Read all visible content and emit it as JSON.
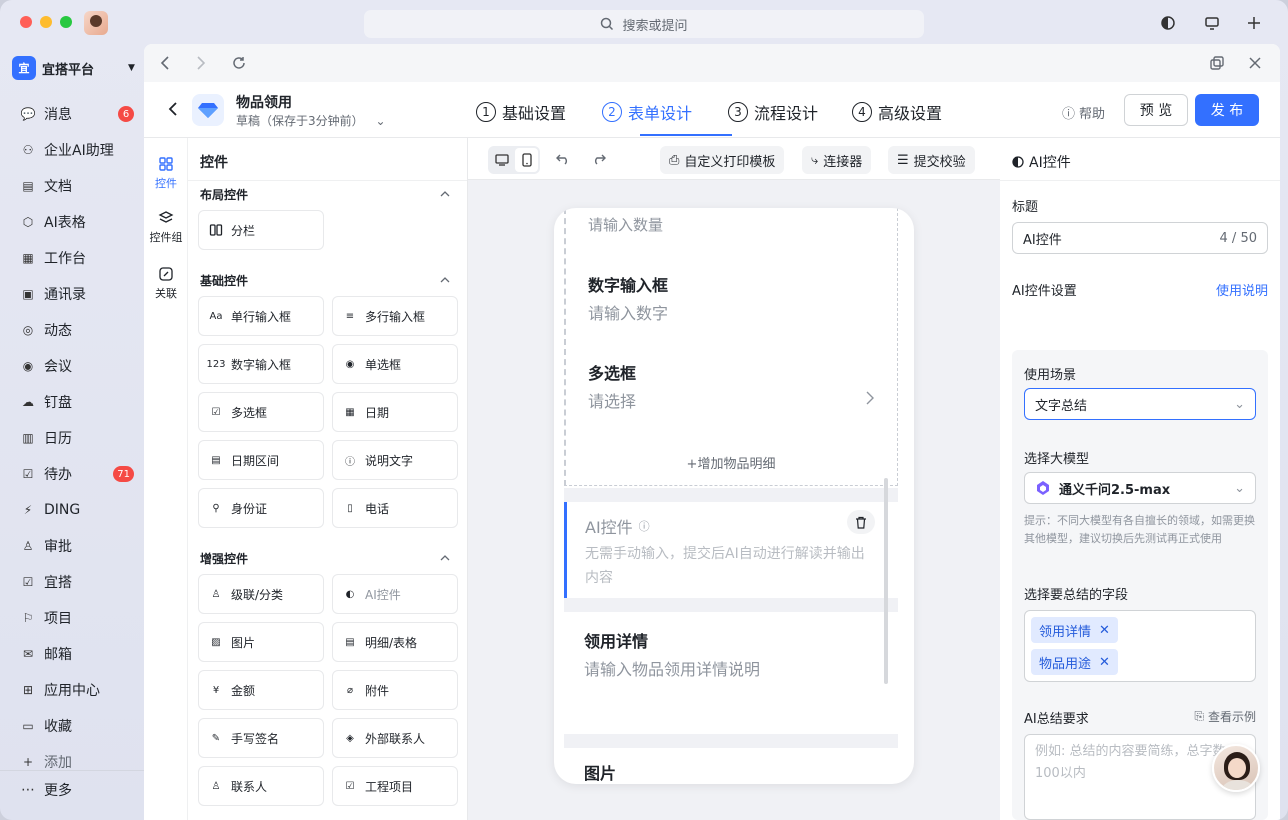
{
  "topbar": {
    "search_placeholder": "搜索或提问"
  },
  "org": {
    "logo_text": "宜",
    "name": "宜搭平台"
  },
  "nav": [
    {
      "label": "消息",
      "badge": "6",
      "icon": "chat-bubble-icon"
    },
    {
      "label": "企业AI助理",
      "icon": "ai-assistant-icon"
    },
    {
      "label": "文档",
      "icon": "document-icon"
    },
    {
      "label": "AI表格",
      "icon": "ai-table-icon"
    },
    {
      "label": "工作台",
      "icon": "grid-icon"
    },
    {
      "label": "通讯录",
      "icon": "contacts-icon"
    },
    {
      "label": "动态",
      "icon": "feed-icon"
    },
    {
      "label": "会议",
      "icon": "meeting-icon"
    },
    {
      "label": "钉盘",
      "icon": "cloud-drive-icon"
    },
    {
      "label": "日历",
      "icon": "calendar-icon"
    },
    {
      "label": "待办",
      "badge": "71",
      "icon": "todo-icon"
    },
    {
      "label": "DING",
      "icon": "ding-icon"
    },
    {
      "label": "审批",
      "icon": "approval-icon"
    },
    {
      "label": "宜搭",
      "icon": "yida-icon"
    },
    {
      "label": "项目",
      "icon": "project-icon"
    },
    {
      "label": "邮箱",
      "icon": "mail-icon"
    },
    {
      "label": "应用中心",
      "icon": "app-center-icon"
    },
    {
      "label": "收藏",
      "icon": "favorite-icon"
    },
    {
      "label": "添加",
      "icon": "add-icon"
    }
  ],
  "nav_more": "更多",
  "app": {
    "title": "物品领用",
    "subtitle": "草稿（保存于3分钟前）"
  },
  "steps": [
    {
      "num": "1",
      "label": "基础设置"
    },
    {
      "num": "2",
      "label": "表单设计"
    },
    {
      "num": "3",
      "label": "流程设计"
    },
    {
      "num": "4",
      "label": "高级设置"
    }
  ],
  "header_actions": {
    "help": "帮助",
    "preview": "预 览",
    "publish": "发 布"
  },
  "rail": [
    {
      "label": "控件"
    },
    {
      "label": "控件组"
    },
    {
      "label": "关联"
    }
  ],
  "widgets": {
    "title": "控件",
    "layout_title": "布局控件",
    "layout": [
      {
        "label": "分栏"
      }
    ],
    "basic_title": "基础控件",
    "basic": [
      {
        "label": "单行输入框",
        "glyph": "Aa"
      },
      {
        "label": "多行输入框",
        "glyph": "≡"
      },
      {
        "label": "数字输入框",
        "glyph": "123"
      },
      {
        "label": "单选框",
        "glyph": "◉"
      },
      {
        "label": "多选框",
        "glyph": "☑"
      },
      {
        "label": "日期",
        "glyph": "▦"
      },
      {
        "label": "日期区间",
        "glyph": "▤"
      },
      {
        "label": "说明文字",
        "glyph": "ⓘ"
      },
      {
        "label": "身份证",
        "glyph": "⚲"
      },
      {
        "label": "电话",
        "glyph": "▯"
      }
    ],
    "enhanced_title": "增强控件",
    "enhanced": [
      {
        "label": "级联/分类",
        "glyph": "♙"
      },
      {
        "label": "AI控件",
        "glyph": "◐"
      },
      {
        "label": "图片",
        "glyph": "▨"
      },
      {
        "label": "明细/表格",
        "glyph": "▤"
      },
      {
        "label": "金额",
        "glyph": "¥"
      },
      {
        "label": "附件",
        "glyph": "⌀"
      },
      {
        "label": "手写签名",
        "glyph": "✎"
      },
      {
        "label": "外部联系人",
        "glyph": "◈"
      },
      {
        "label": "联系人",
        "glyph": "♙"
      },
      {
        "label": "工程项目",
        "glyph": "☑"
      }
    ]
  },
  "canvas_toolbar": {
    "print": "自定义打印模板",
    "connector": "连接器",
    "validate": "提交校验"
  },
  "form": {
    "top_cut_placeholder": "请输入数量",
    "number_label": "数字输入框",
    "number_ph": "请输入数字",
    "multi_label": "多选框",
    "multi_ph": "请选择",
    "add_detail": "+增加物品明细",
    "ai_label": "AI控件",
    "ai_desc": "无需手动输入，提交后AI自动进行解读并输出内容",
    "detail_label": "领用详情",
    "detail_ph": "请输入物品领用详情说明",
    "image_label": "图片"
  },
  "props": {
    "title": "AI控件",
    "title_label": "标题",
    "title_value": "AI控件",
    "title_count": "4 / 50",
    "settings_label": "AI控件设置",
    "usage_link": "使用说明",
    "scene_label": "使用场景",
    "scene_value": "文字总结",
    "model_label": "选择大模型",
    "model_value": "通义千问2.5-max",
    "hint": "提示：不同大模型有各自擅长的领域，如需更换其他模型，建议切换后先测试再正式使用",
    "fields_label": "选择要总结的字段",
    "fields": [
      "领用详情",
      "物品用途"
    ],
    "req_label": "AI总结要求",
    "example_link": "查看示例",
    "req_placeholder": "例如: 总结的内容要简练，总字数100以内"
  }
}
